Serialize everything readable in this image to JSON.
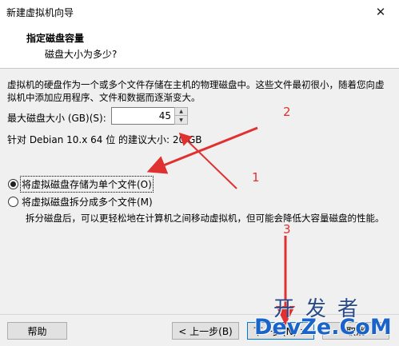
{
  "window": {
    "title": "新建虚拟机向导",
    "close_glyph": "✕"
  },
  "header": {
    "title": "指定磁盘容量",
    "subtitle": "磁盘大小为多少?"
  },
  "description": "虚拟机的硬盘作为一个或多个文件存储在主机的物理磁盘中。这些文件最初很小，随着您向虚拟机中添加应用程序、文件和数据而逐渐变大。",
  "disk_size": {
    "label": "最大磁盘大小 (GB)(S):",
    "value": "45"
  },
  "recommendation": "针对 Debian 10.x 64 位 的建议大小: 20 GB",
  "options": [
    {
      "label": "将虚拟磁盘存储为单个文件(O)",
      "selected": true
    },
    {
      "label": "将虚拟磁盘拆分成多个文件(M)",
      "selected": false
    }
  ],
  "split_description": "拆分磁盘后，可以更轻松地在计算机之间移动虚拟机，但可能会降低大容量磁盘的性能。",
  "buttons": {
    "help": "帮助",
    "back": "< 上一步(B)",
    "next": "下一步(N) >",
    "cancel": "取消"
  },
  "annotations": {
    "one": "1",
    "two": "2",
    "three": "3",
    "color": "#e03030"
  },
  "watermark": {
    "line1": "开发者",
    "line2": "DevZe.CoM"
  }
}
